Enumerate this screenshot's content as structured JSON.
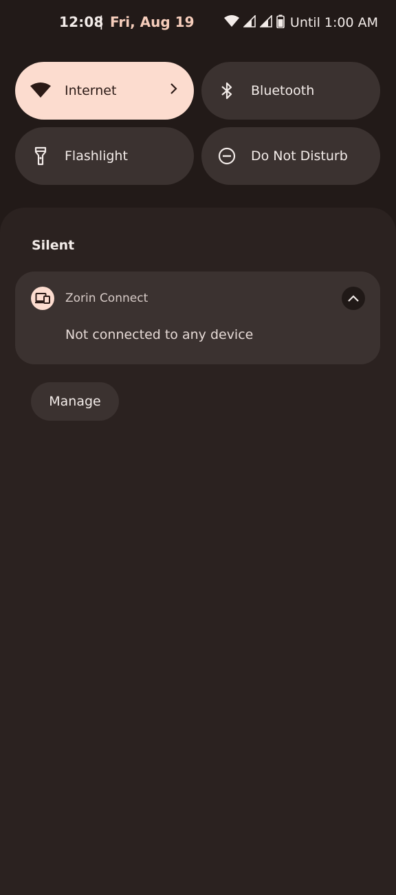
{
  "status_bar": {
    "time": "12:08",
    "separator": "|",
    "date": "Fri, Aug 19",
    "battery_text": "Until 1:00 AM",
    "icons": [
      "wifi-icon",
      "signal-icon",
      "signal-icon",
      "battery-icon"
    ]
  },
  "quick_tiles": [
    {
      "label": "Internet",
      "icon": "wifi-icon",
      "active": true
    },
    {
      "label": "Bluetooth",
      "icon": "bluetooth-icon",
      "active": false
    },
    {
      "label": "Flashlight",
      "icon": "flashlight-icon",
      "active": false
    },
    {
      "label": "Do Not Disturb",
      "icon": "do-not-disturb-icon",
      "active": false
    }
  ],
  "notifications": {
    "section_title": "Silent",
    "items": [
      {
        "app_name": "Zorin Connect",
        "text": "Not connected to any device",
        "icon": "devices-icon"
      }
    ],
    "manage_label": "Manage"
  },
  "colors": {
    "background": "#221a18",
    "shade": "#2b2220",
    "tile": "#3b3230",
    "accent": "#fcdccf",
    "date_text": "#f6cdbb"
  }
}
